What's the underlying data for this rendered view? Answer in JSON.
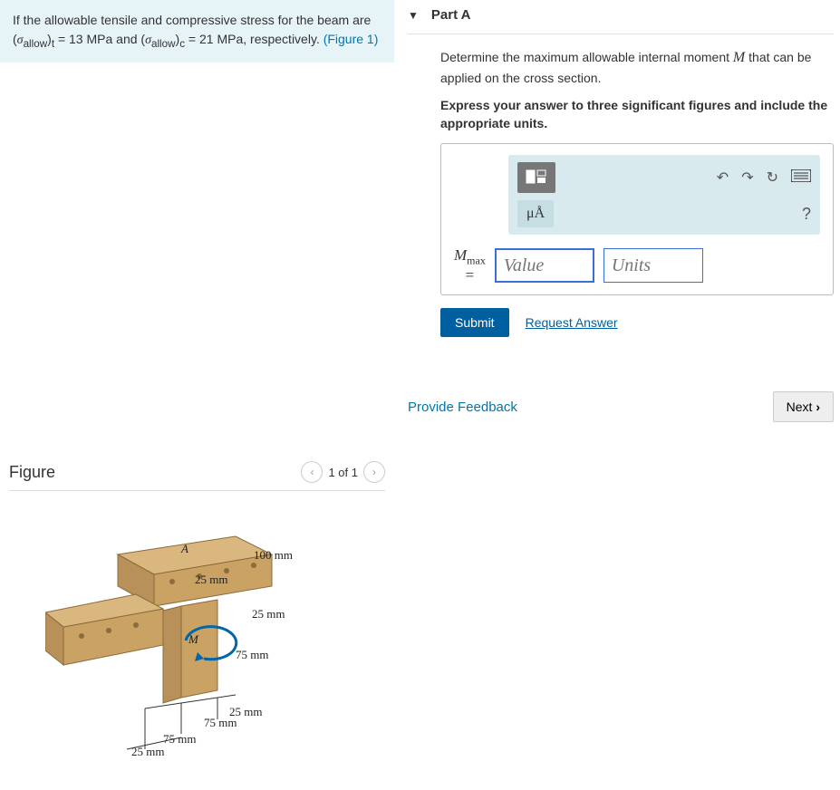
{
  "problem": {
    "text_prefix": "If the allowable tensile and compressive stress for the beam are (",
    "sigma_allow": "σ",
    "sub_allow": "allow",
    "sub_t": "t",
    "eq1": " = 13  MPa and (",
    "sub_c": "c",
    "eq2": " = 21 MPa, respectively. ",
    "figure_link": "(Figure 1)"
  },
  "figure": {
    "title": "Figure",
    "pager": "1 of 1",
    "labels": {
      "A": "A",
      "M": "M",
      "d100": "100 mm",
      "d25a": "25 mm",
      "d25b": "25 mm",
      "d75a": "75 mm",
      "d25c": "25 mm",
      "d75b": "75 mm",
      "d75c": "75 mm",
      "d25d": "25 mm"
    }
  },
  "part": {
    "label": "Part A",
    "desc_prefix": "Determine the maximum allowable internal moment ",
    "desc_var": "M",
    "desc_suffix": " that can be applied on the cross section.",
    "instruction": "Express your answer to three significant figures and include the appropriate units.",
    "mu_label": "μÅ",
    "var": "M",
    "var_sub": "max",
    "eq": "=",
    "value_placeholder": "Value",
    "units_placeholder": "Units",
    "submit": "Submit",
    "request": "Request Answer",
    "help": "?"
  },
  "footer": {
    "feedback": "Provide Feedback",
    "next": "Next"
  }
}
